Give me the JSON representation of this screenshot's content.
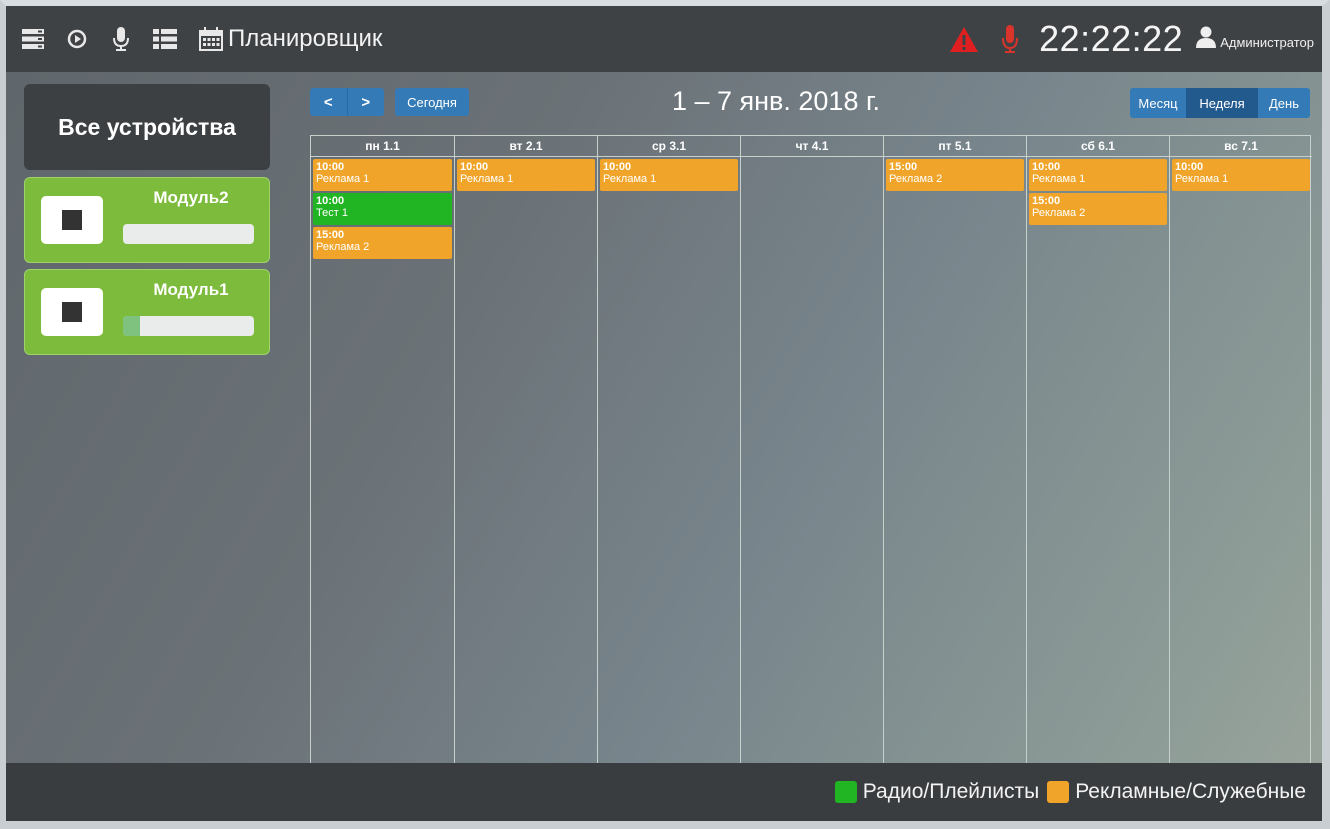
{
  "topbar": {
    "title": "Планировщик",
    "clock": "22:22:22",
    "user": "Администратор"
  },
  "sidebar": {
    "all_devices": "Все устройства",
    "modules": [
      {
        "name": "Модуль2",
        "progress": 0.0
      },
      {
        "name": "Модуль1",
        "progress": 0.13
      }
    ]
  },
  "calendar": {
    "prev": "<",
    "next": ">",
    "today": "Сегодня",
    "title": "1 – 7 янв. 2018 г.",
    "views": [
      "Месяц",
      "Неделя",
      "День"
    ],
    "active_view": "Неделя",
    "days": [
      {
        "label": "пн 1.1",
        "events": [
          {
            "time": "10:00",
            "name": "Реклама 1",
            "kind": "ad"
          },
          {
            "time": "10:00",
            "name": "Тест 1",
            "kind": "radio"
          },
          {
            "time": "15:00",
            "name": "Реклама 2",
            "kind": "ad"
          }
        ]
      },
      {
        "label": "вт 2.1",
        "events": [
          {
            "time": "10:00",
            "name": "Реклама 1",
            "kind": "ad"
          }
        ]
      },
      {
        "label": "ср 3.1",
        "events": [
          {
            "time": "10:00",
            "name": "Реклама 1",
            "kind": "ad"
          }
        ]
      },
      {
        "label": "чт 4.1",
        "events": []
      },
      {
        "label": "пт 5.1",
        "events": [
          {
            "time": "15:00",
            "name": "Реклама 2",
            "kind": "ad"
          }
        ]
      },
      {
        "label": "сб 6.1",
        "events": [
          {
            "time": "10:00",
            "name": "Реклама 1",
            "kind": "ad"
          },
          {
            "time": "15:00",
            "name": "Реклама 2",
            "kind": "ad"
          }
        ]
      },
      {
        "label": "вс 7.1",
        "events": [
          {
            "time": "10:00",
            "name": "Реклама 1",
            "kind": "ad"
          }
        ]
      }
    ]
  },
  "legend": [
    {
      "label": "Радио/Плейлисты",
      "color": "#22b523"
    },
    {
      "label": "Рекламные/Служебные",
      "color": "#f0a52a"
    }
  ],
  "colors": {
    "alert": "#e02020",
    "mic_alert": "#d9342b",
    "button_blue": "#337ab7",
    "module_green": "#7cbb3c"
  },
  "icons": [
    "server-icon",
    "play-circle-icon",
    "microphone-icon",
    "list-icon",
    "calendar-icon",
    "warning-icon",
    "microphone-alert-icon",
    "user-icon",
    "stop-icon"
  ]
}
